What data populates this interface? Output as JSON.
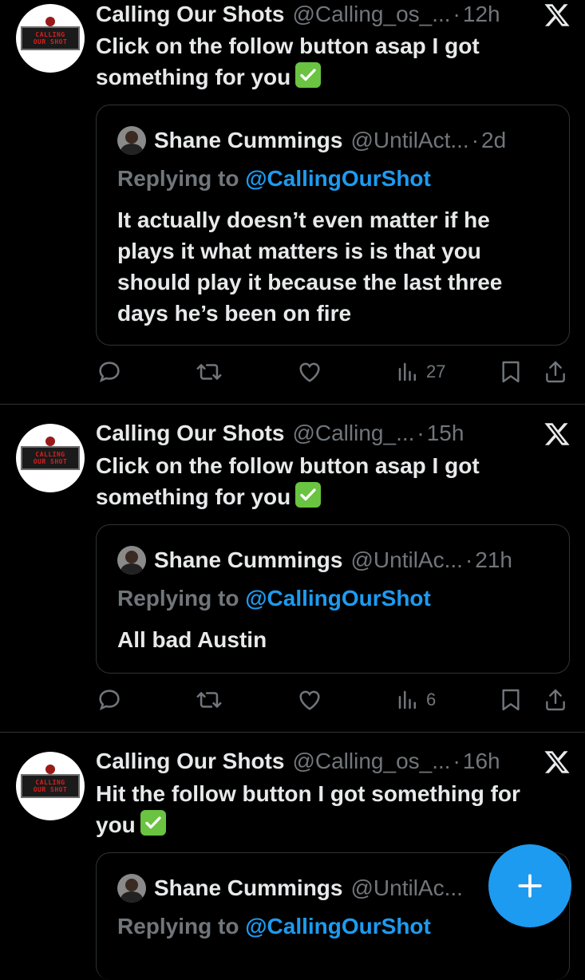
{
  "tweets": [
    {
      "author_name": "Calling Our Shots",
      "author_handle": "@Calling_os_...",
      "dot": "·",
      "time": "12h",
      "text": "Click on the follow button asap I got something for you",
      "quote": {
        "author_name": "Shane Cummings",
        "author_handle": "@UntilAct...",
        "dot": "·",
        "time": "2d",
        "replying_prefix": "Replying to ",
        "replying_to": "@CallingOurShot",
        "text": "It actually doesn’t even matter if he plays it what matters is is that you should play it because the last three days he’s been on fire"
      },
      "views": "27"
    },
    {
      "author_name": "Calling Our Shots",
      "author_handle": "@Calling_...",
      "dot": "·",
      "time": "15h",
      "text": "Click on the follow button asap I got something for you",
      "quote": {
        "author_name": "Shane Cummings",
        "author_handle": "@UntilAc...",
        "dot": "·",
        "time": "21h",
        "replying_prefix": "Replying to ",
        "replying_to": "@CallingOurShot",
        "text": "All bad Austin"
      },
      "views": "6"
    },
    {
      "author_name": "Calling Our Shots",
      "author_handle": "@Calling_os_...",
      "dot": "·",
      "time": "16h",
      "text_line1": "Hit the follow button I got something for",
      "text_line2": "you",
      "quote": {
        "author_name": "Shane Cummings",
        "author_handle": "@UntilAc...",
        "replying_prefix": "Replying to ",
        "replying_to": "@CallingOurShot"
      }
    }
  ],
  "avatar_logo_text": [
    "CALLING",
    "OUR SHOT"
  ],
  "colors": {
    "background": "#000000",
    "text": "#e7e9ea",
    "muted": "#71767b",
    "accent": "#1d9bf0",
    "check": "#6ac341",
    "divider": "#2f3336"
  },
  "icons": {
    "brand": "x-logo-icon",
    "reply": "reply-icon",
    "retweet": "retweet-icon",
    "like": "heart-icon",
    "views": "views-icon",
    "bookmark": "bookmark-icon",
    "share": "share-icon",
    "compose": "plus-icon"
  }
}
